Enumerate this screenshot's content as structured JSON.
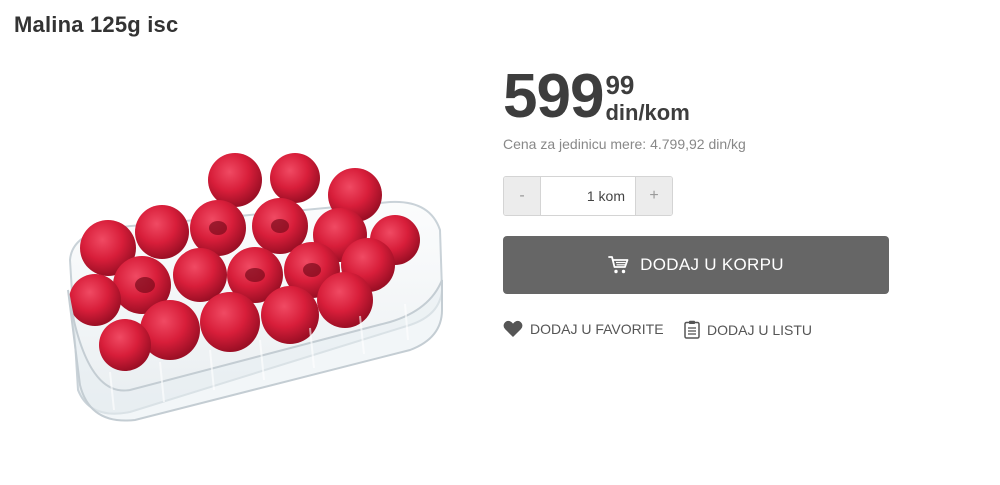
{
  "product": {
    "title": "Malina 125g isc",
    "image_alt": "Malina"
  },
  "price": {
    "main": "599",
    "decimals": "99",
    "unit": "din/kom",
    "unit_price_text": "Cena za jedinicu mere: 4.799,92 din/kg"
  },
  "quantity": {
    "decrement_label": "-",
    "increment_label": "+",
    "value": "1 kom"
  },
  "actions": {
    "add_to_cart_label": "DODAJ U KORPU",
    "add_to_cart_icon": "cart-icon",
    "favorite_label": "DODAJ U FAVORITE",
    "favorite_icon": "heart-icon",
    "list_label": "DODAJ U LISTU",
    "list_icon": "list-icon"
  },
  "colors": {
    "button_bg": "#666666",
    "text_dark": "#3d3d3d",
    "text_muted": "#888888",
    "raspberry": "#d81e3a"
  }
}
